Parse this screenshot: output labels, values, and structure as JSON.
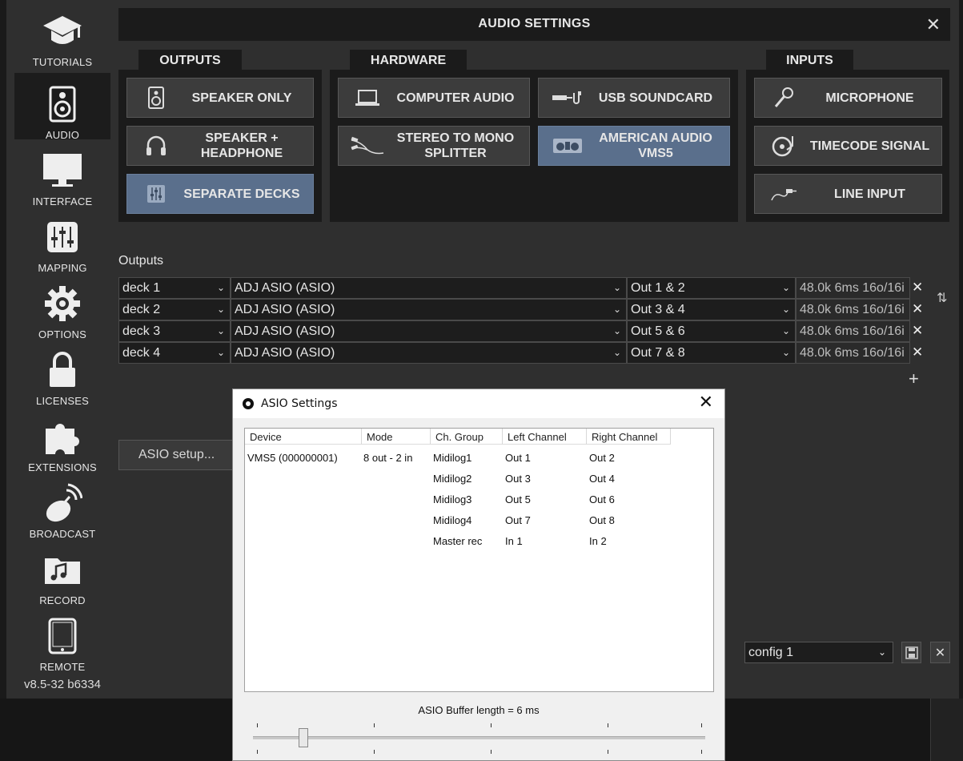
{
  "sidebar": {
    "items": [
      {
        "label": "TUTORIALS",
        "icon": "graduation-cap-icon"
      },
      {
        "label": "AUDIO",
        "icon": "speaker-icon",
        "active": true
      },
      {
        "label": "INTERFACE",
        "icon": "monitor-icon"
      },
      {
        "label": "MAPPING",
        "icon": "sliders-icon"
      },
      {
        "label": "OPTIONS",
        "icon": "gear-icon"
      },
      {
        "label": "LICENSES",
        "icon": "lock-icon"
      },
      {
        "label": "EXTENSIONS",
        "icon": "puzzle-icon"
      },
      {
        "label": "BROADCAST",
        "icon": "satellite-dish-icon"
      },
      {
        "label": "RECORD",
        "icon": "music-folder-icon"
      },
      {
        "label": "REMOTE",
        "icon": "tablet-icon"
      }
    ],
    "version": "v8.5-32 b6334"
  },
  "dialog": {
    "title": "AUDIO SETTINGS",
    "close": "✕"
  },
  "sections": {
    "outputs": {
      "title": "OUTPUTS",
      "buttons": [
        {
          "label": "SPEAKER ONLY",
          "icon": "speaker-icon",
          "selected": false
        },
        {
          "label": "SPEAKER + HEADPHONE",
          "icon": "headphones-icon",
          "selected": false
        },
        {
          "label": "SEPARATE DECKS",
          "icon": "mixer-icon",
          "selected": true
        }
      ]
    },
    "hardware": {
      "title": "HARDWARE",
      "buttons": [
        {
          "label": "COMPUTER AUDIO",
          "icon": "laptop-icon",
          "selected": false
        },
        {
          "label": "USB SOUNDCARD",
          "icon": "usb-cable-icon",
          "selected": false
        },
        {
          "label": "STEREO TO MONO SPLITTER",
          "icon": "splitter-cable-icon",
          "selected": false
        },
        {
          "label": "AMERICAN AUDIO VMS5",
          "icon": "controller-icon",
          "selected": true
        }
      ]
    },
    "inputs": {
      "title": "INPUTS",
      "buttons": [
        {
          "label": "MICROPHONE",
          "icon": "microphone-icon",
          "selected": false
        },
        {
          "label": "TIMECODE SIGNAL",
          "icon": "turntable-icon",
          "selected": false
        },
        {
          "label": "LINE INPUT",
          "icon": "jack-cable-icon",
          "selected": false
        }
      ]
    }
  },
  "outputs_table": {
    "label": "Outputs",
    "rows": [
      {
        "deck": "deck 1",
        "device": "ADJ ASIO (ASIO)",
        "channel": "Out 1 & 2",
        "info": "48.0k 6ms 16o/16i"
      },
      {
        "deck": "deck 2",
        "device": "ADJ ASIO (ASIO)",
        "channel": "Out 3 & 4",
        "info": "48.0k 6ms 16o/16i"
      },
      {
        "deck": "deck 3",
        "device": "ADJ ASIO (ASIO)",
        "channel": "Out 5 & 6",
        "info": "48.0k 6ms 16o/16i"
      },
      {
        "deck": "deck 4",
        "device": "ADJ ASIO (ASIO)",
        "channel": "Out 7 & 8",
        "info": "48.0k 6ms 16o/16i"
      }
    ],
    "add": "+",
    "remove": "✕"
  },
  "asio_setup_button": "ASIO setup...",
  "config": {
    "value": "config 1"
  },
  "asio_dialog": {
    "title": "ASIO Settings",
    "close": "✕",
    "columns": [
      "Device",
      "Mode",
      "Ch. Group",
      "Left Channel",
      "Right Channel"
    ],
    "device": "VMS5 (000000001)",
    "mode": "8 out - 2 in",
    "groups": [
      {
        "group": "Midilog1",
        "left": "Out 1",
        "right": "Out 2"
      },
      {
        "group": "Midilog2",
        "left": "Out 3",
        "right": "Out 4"
      },
      {
        "group": "Midilog3",
        "left": "Out 5",
        "right": "Out 6"
      },
      {
        "group": "Midilog4",
        "left": "Out 7",
        "right": "Out 8"
      },
      {
        "group": "Master rec",
        "left": "In 1",
        "right": "In 2"
      }
    ],
    "buffer_label": "ASIO Buffer length = 6 ms",
    "buffer_ms": 6
  }
}
